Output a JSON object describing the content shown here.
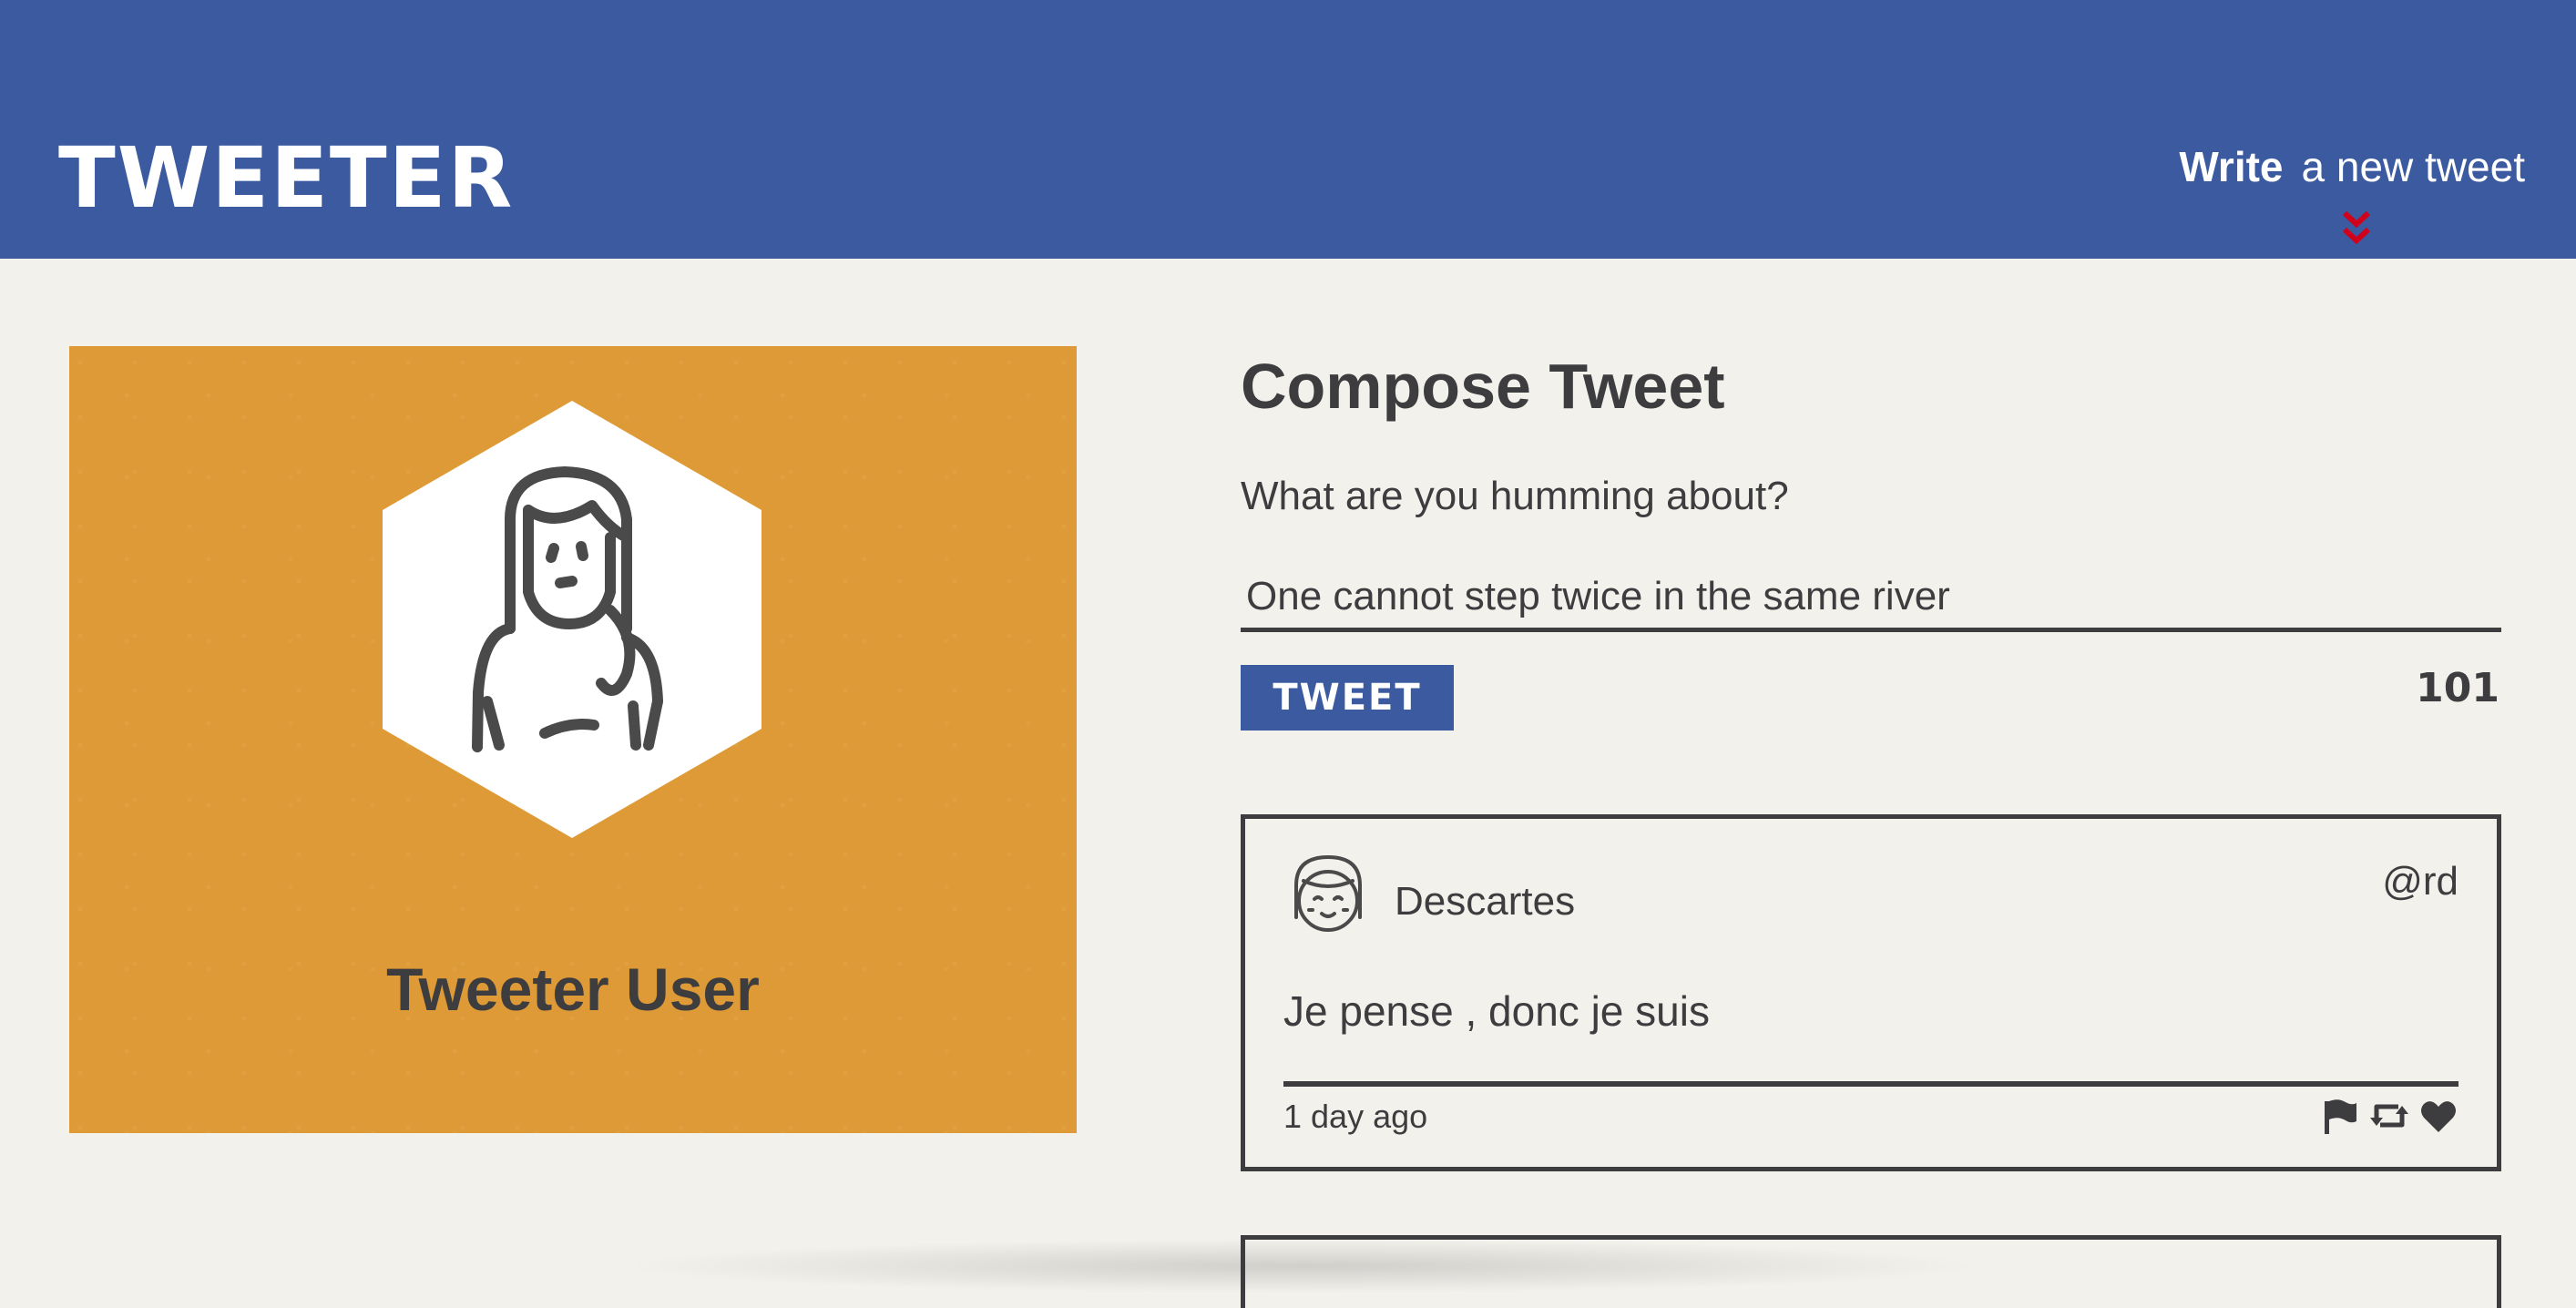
{
  "nav": {
    "brand": "TWEETER",
    "write_strong": "Write",
    "write_rest": "a new tweet",
    "arrow_icon": "double-chevron-down-icon",
    "arrow_color": "#d0021b",
    "bg_color": "#3b5aa0"
  },
  "profile": {
    "name": "Tweeter User",
    "card_color": "#de9a36",
    "avatar_icon": "user-avatar-icon"
  },
  "compose": {
    "title": "Compose Tweet",
    "label": "What are you humming about?",
    "input_value": "One cannot step twice in the same river",
    "button_label": "TWEET",
    "char_count": "101"
  },
  "tweets": [
    {
      "name": "Descartes",
      "handle": "@rd",
      "text": "Je pense , donc je suis",
      "time": "1 day ago",
      "actions": [
        "flag-icon",
        "retweet-icon",
        "heart-icon"
      ]
    }
  ]
}
